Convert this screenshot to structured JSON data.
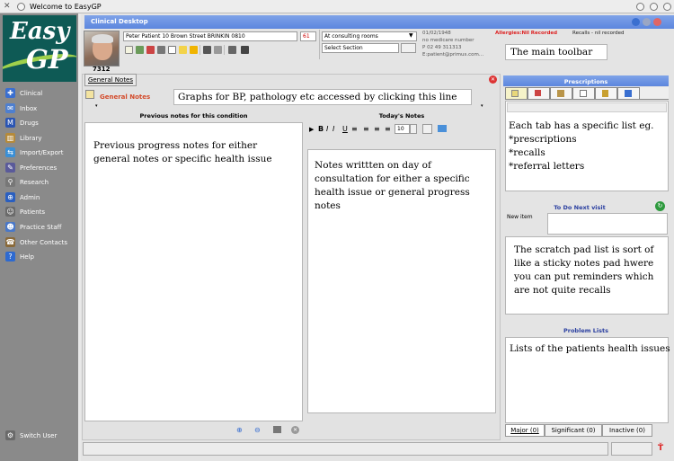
{
  "window": {
    "title": "Welcome to EasyGP"
  },
  "app": {
    "logo_top": "Easy",
    "logo_bottom": "GP",
    "panel_title": "Clinical Desktop"
  },
  "sidebar": {
    "items": [
      {
        "label": "Clinical",
        "icon": "stethoscope-icon",
        "color": "#3a6fd0"
      },
      {
        "label": "Inbox",
        "icon": "inbox-icon",
        "color": "#4e7fcf"
      },
      {
        "label": "Drugs",
        "icon": "drugs-icon",
        "color": "#2a55b3"
      },
      {
        "label": "Library",
        "icon": "library-icon",
        "color": "#b58a3a"
      },
      {
        "label": "Import/Export",
        "icon": "import-export-icon",
        "color": "#3a8fd6"
      },
      {
        "label": "Preferences",
        "icon": "preferences-icon",
        "color": "#5a5a9a"
      },
      {
        "label": "Research",
        "icon": "research-icon",
        "color": "#777"
      },
      {
        "label": "Admin",
        "icon": "admin-icon",
        "color": "#2a5fc0"
      },
      {
        "label": "Patients",
        "icon": "patients-icon",
        "color": "#6a6a6a"
      },
      {
        "label": "Practice Staff",
        "icon": "practice-staff-icon",
        "color": "#4a78c8"
      },
      {
        "label": "Other Contacts",
        "icon": "other-contacts-icon",
        "color": "#8a6a3a"
      },
      {
        "label": "Help",
        "icon": "help-icon",
        "color": "#2e6ad0"
      }
    ],
    "switch_user": "Switch User"
  },
  "patient": {
    "name_address": "Peter Patient 10 Brown Street BRINKIN 0810",
    "age": "61",
    "dob": "01/02/1948",
    "medicare": "no medicare number",
    "phone": "P 02 49 311313",
    "email": "E:patient@primus.com...",
    "id": "7312",
    "allergies": "Allergies:Nil Recorded",
    "recalls": "Recalls - nil recorded"
  },
  "consult": {
    "location": "At consulting rooms",
    "section_placeholder": "Select Section"
  },
  "annotations": {
    "toolbar": "The main toolbar",
    "graphs": "Graphs for BP, pathology etc accessed by clicking this line",
    "previous": "Previous progress notes for either general notes or specific health issue",
    "today": "Notes writtten on day of  consultation for either a specific health issue or general progress notes",
    "tabs": "Each tab has a specific list eg.\n*prescriptions\n*recalls\n*referral letters",
    "scratch": "The scratch pad list is sort of like a sticky notes pad hwere you can put reminders which are not quite recalls",
    "problems": "Lists of the patients health issues"
  },
  "notes": {
    "tab_label": "General Notes",
    "section_label": "General Notes",
    "previous_header": "Previous notes for this condition",
    "today_header": "Today's Notes",
    "font_size": "10"
  },
  "right": {
    "prescriptions_header": "Prescriptions",
    "todo_header": "To Do Next visit",
    "new_item_label": "New item",
    "problem_header": "Problem Lists",
    "tabs": [
      "Major (0)",
      "Significant (0)",
      "Inactive (0)"
    ]
  }
}
